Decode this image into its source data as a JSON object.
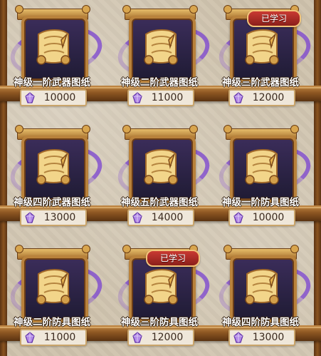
{
  "items": [
    {
      "label": "神级一阶武器图纸",
      "price": "10000",
      "learned": false
    },
    {
      "label": "神级二阶武器图纸",
      "price": "11000",
      "learned": false
    },
    {
      "label": "神级三阶武器图纸",
      "price": "12000",
      "learned": true,
      "badge": "已学习"
    },
    {
      "label": "神级四阶武器图纸",
      "price": "13000",
      "learned": false
    },
    {
      "label": "神级五阶武器图纸",
      "price": "14000",
      "learned": false
    },
    {
      "label": "神级一阶防具图纸",
      "price": "10000",
      "learned": false
    },
    {
      "label": "神级二阶防具图纸",
      "price": "11000",
      "learned": false
    },
    {
      "label": "神级三阶防具图纸",
      "price": "12000",
      "learned": true,
      "badge": "已学习"
    },
    {
      "label": "神级四阶防具图纸",
      "price": "13000",
      "learned": false
    }
  ],
  "icons": {
    "item": "blueprint-scroll-icon",
    "currency": "purple-gem-icon"
  },
  "colors": {
    "shelf_wood": "#8e5722",
    "badge_red": "#c93a33",
    "magic_purple": "#7a42d2"
  }
}
